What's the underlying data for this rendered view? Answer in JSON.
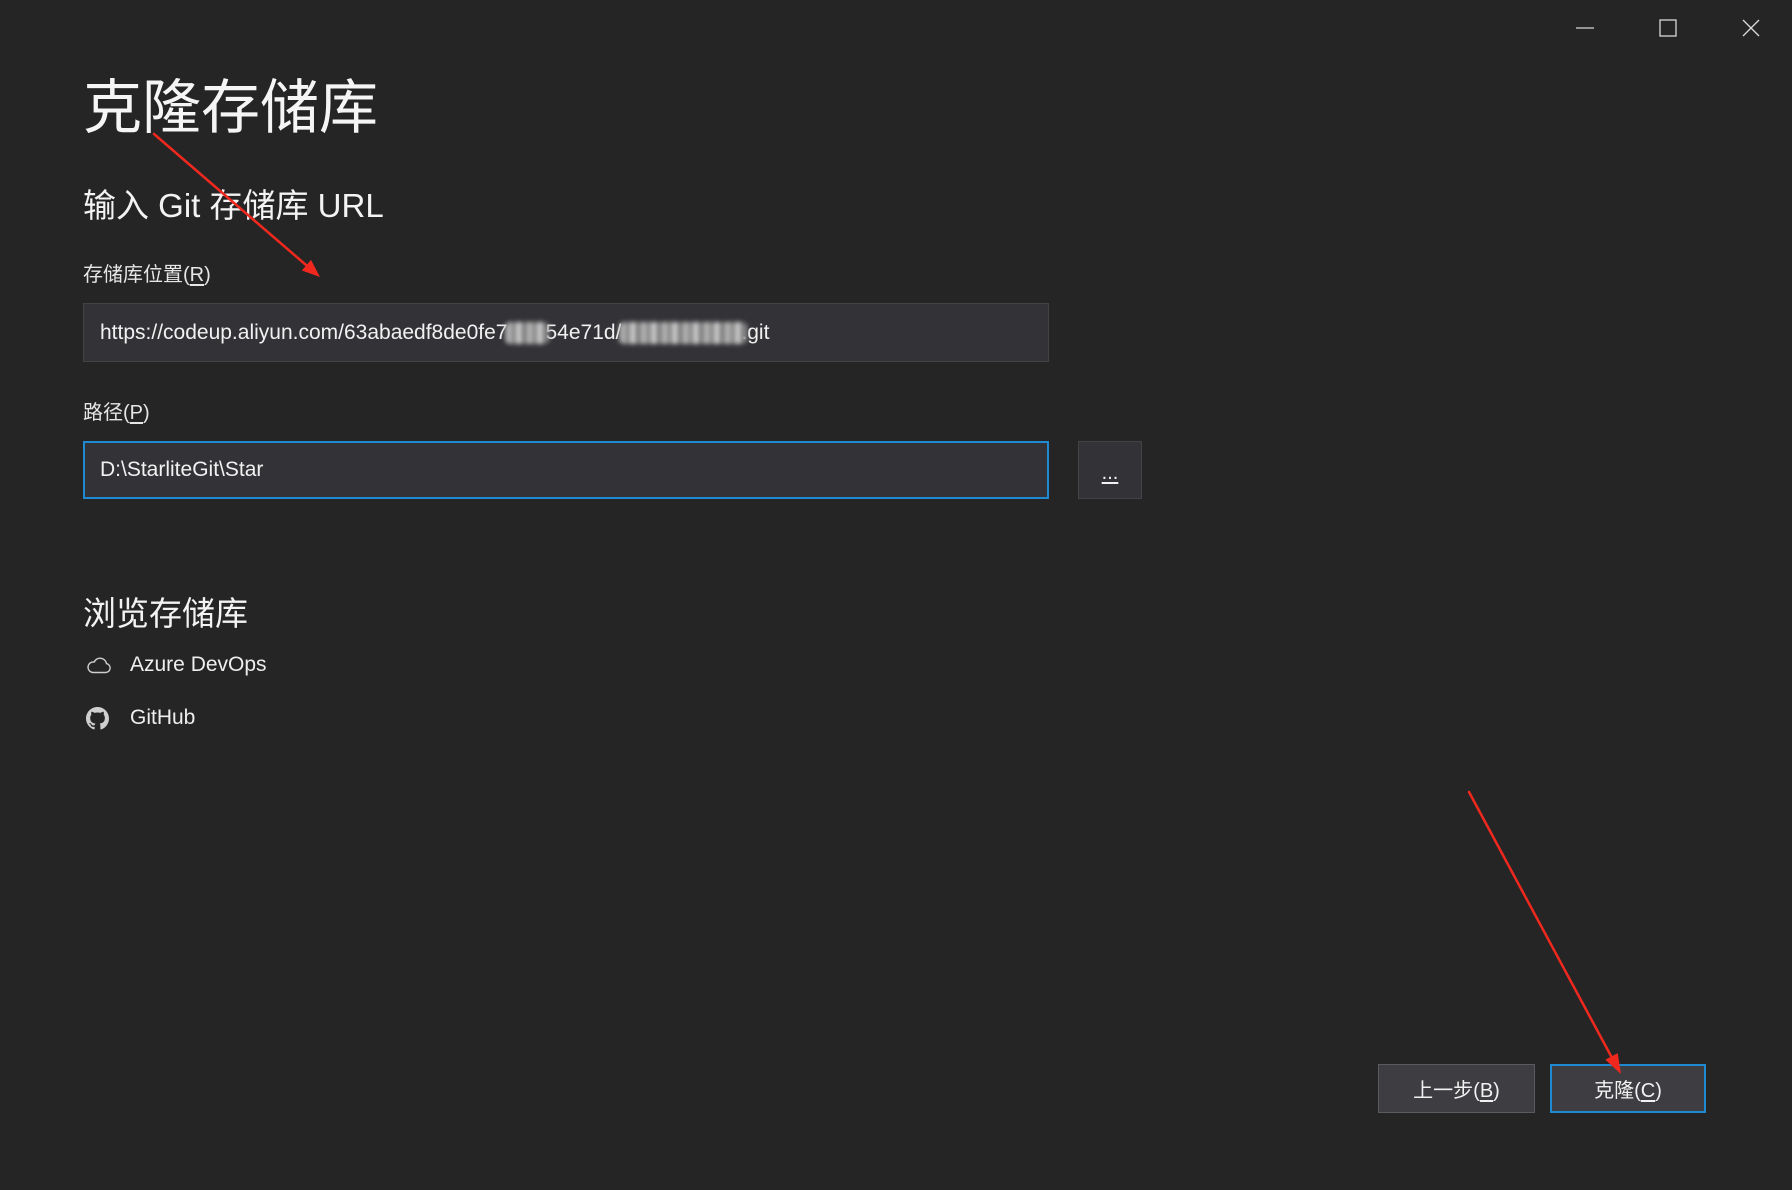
{
  "window": {
    "controls": {
      "minimize_icon": "minimize-icon",
      "maximize_icon": "maximize-icon",
      "close_icon": "close-icon"
    }
  },
  "page": {
    "title": "克隆存储库",
    "subtitle": "输入 Git 存储库 URL"
  },
  "repo_location": {
    "label": "存储库位置(R)",
    "url_segments": {
      "prefix": "https://codeup.aliyun.com/63abaedf8de0fe7",
      "middle": "54e71d/",
      "suffix": ".git"
    }
  },
  "path": {
    "label": "路径(P)",
    "value": "D:\\StarliteGit\\Star",
    "browse_label": "..."
  },
  "browse": {
    "heading": "浏览存储库",
    "providers": [
      {
        "label": "Azure DevOps",
        "icon": "cloud-icon"
      },
      {
        "label": "GitHub",
        "icon": "github-icon"
      }
    ]
  },
  "footer": {
    "back_label": "上一步(B)",
    "clone_label": "克隆(C)"
  },
  "colors": {
    "background": "#252526",
    "text": "#f1f1f1",
    "input_background": "#333337",
    "input_border": "#434346",
    "focus_border": "#1f8ad2",
    "button_background": "#3e3e42",
    "button_border": "#5a5a60",
    "icon": "#cfcfcf",
    "annotation_arrow": "#f0281e"
  }
}
